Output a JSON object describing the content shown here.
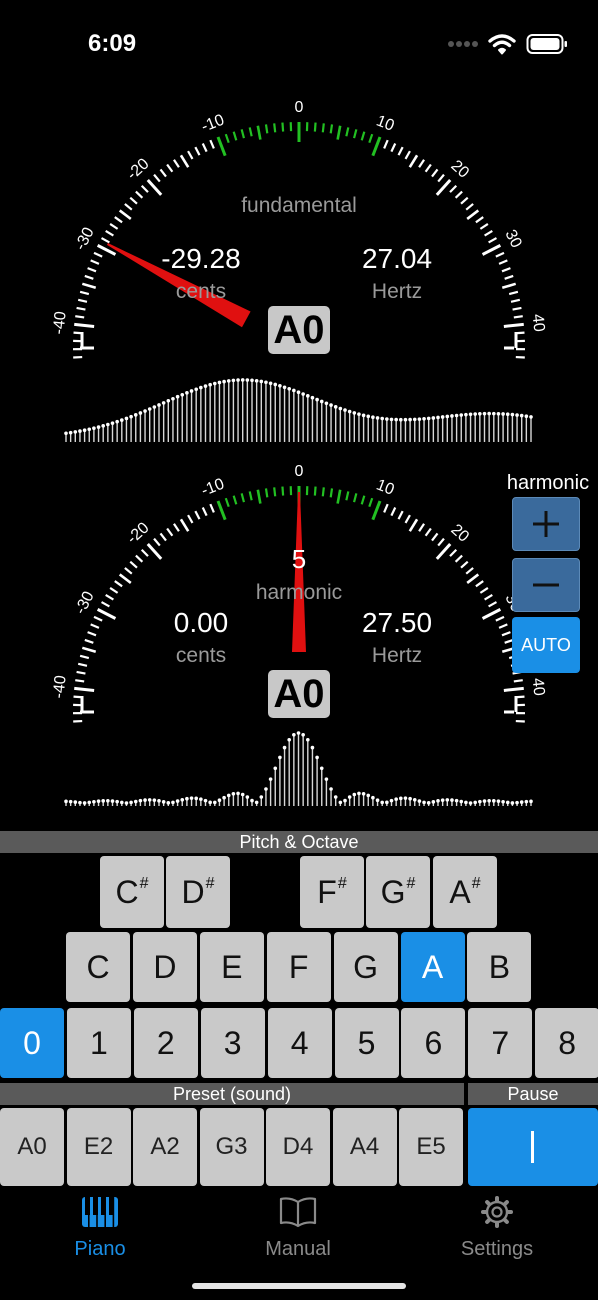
{
  "status_bar": {
    "time": "6:09"
  },
  "colors": {
    "accent": "#1a8fe6",
    "needle": "#e01010",
    "in_tune": "#22c022",
    "key_bg": "#c9c9c9",
    "section_bg": "#5a5a5a"
  },
  "gauge_scale_labels": [
    "-40",
    "-30",
    "-20",
    "-10",
    "0",
    "10",
    "20",
    "30",
    "40"
  ],
  "fundamental": {
    "title": "fundamental",
    "cents_value": "-29.28",
    "cents_label": "cents",
    "hertz_value": "27.04",
    "hertz_label": "Hertz",
    "note": "A0",
    "needle_cents": -29.28
  },
  "harmonic_meter": {
    "harmonic_number": "5",
    "title": "harmonic",
    "cents_value": "0.00",
    "cents_label": "cents",
    "hertz_value": "27.50",
    "hertz_label": "Hertz",
    "note": "A0",
    "needle_cents": 0
  },
  "harmonic_controls": {
    "title": "harmonic",
    "plus_icon": "plus-icon",
    "minus_icon": "minus-icon",
    "auto_label": "AUTO"
  },
  "pitch_octave": {
    "title": "Pitch & Octave",
    "sharps": [
      "C",
      "D",
      "F",
      "G",
      "A"
    ],
    "sharp_symbol": "#",
    "naturals": [
      "C",
      "D",
      "E",
      "F",
      "G",
      "A",
      "B"
    ],
    "selected_natural": "A",
    "octaves": [
      "0",
      "1",
      "2",
      "3",
      "4",
      "5",
      "6",
      "7",
      "8"
    ],
    "selected_octave": "0"
  },
  "preset": {
    "title": "Preset (sound)",
    "items": [
      "A0",
      "E2",
      "A2",
      "G3",
      "D4",
      "A4",
      "E5"
    ]
  },
  "pause": {
    "title": "Pause"
  },
  "tabs": [
    {
      "label": "Piano",
      "icon": "piano-icon",
      "active": true
    },
    {
      "label": "Manual",
      "icon": "book-icon",
      "active": false
    },
    {
      "label": "Settings",
      "icon": "gear-icon",
      "active": false
    }
  ]
}
